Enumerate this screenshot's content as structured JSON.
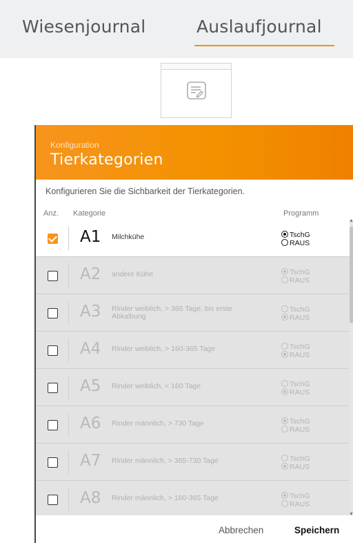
{
  "tabs": [
    {
      "label": "Wiesenjournal"
    },
    {
      "label": "Auslaufjournal"
    }
  ],
  "accent_color": "#f39200",
  "dialog": {
    "subtitle": "Konfiguration",
    "title": "Tierkategorien",
    "description": "Konfigurieren Sie die Sichbarkeit der Tierkategorien.",
    "columns": {
      "anz": "Anz.",
      "kategorie": "Kategorie",
      "programm": "Programm"
    },
    "option_labels": {
      "tschg": "TschG",
      "raus": "RAUS"
    },
    "rows": [
      {
        "code": "A1",
        "name": "Milchkühe",
        "checked": true,
        "program": "TschG"
      },
      {
        "code": "A2",
        "name": "andere Kühe",
        "checked": false,
        "program": "TschG"
      },
      {
        "code": "A3",
        "name": "Rinder weiblich, > 365 Tage, bis erste Abkalbung",
        "checked": false,
        "program": "RAUS"
      },
      {
        "code": "A4",
        "name": "Rinder weiblich, > 160-365 Tage",
        "checked": false,
        "program": "RAUS"
      },
      {
        "code": "A5",
        "name": "Rinder weiblich, < 160 Tage",
        "checked": false,
        "program": "RAUS"
      },
      {
        "code": "A6",
        "name": "Rinder männlich, > 730 Tage",
        "checked": false,
        "program": "TschG"
      },
      {
        "code": "A7",
        "name": "Rinder männlich, > 365-730 Tage",
        "checked": false,
        "program": "RAUS"
      },
      {
        "code": "A8",
        "name": "Rinder männlich, > 160-365 Tage",
        "checked": false,
        "program": "TschG"
      }
    ],
    "cancel_label": "Abbrechen",
    "save_label": "Speichern"
  }
}
